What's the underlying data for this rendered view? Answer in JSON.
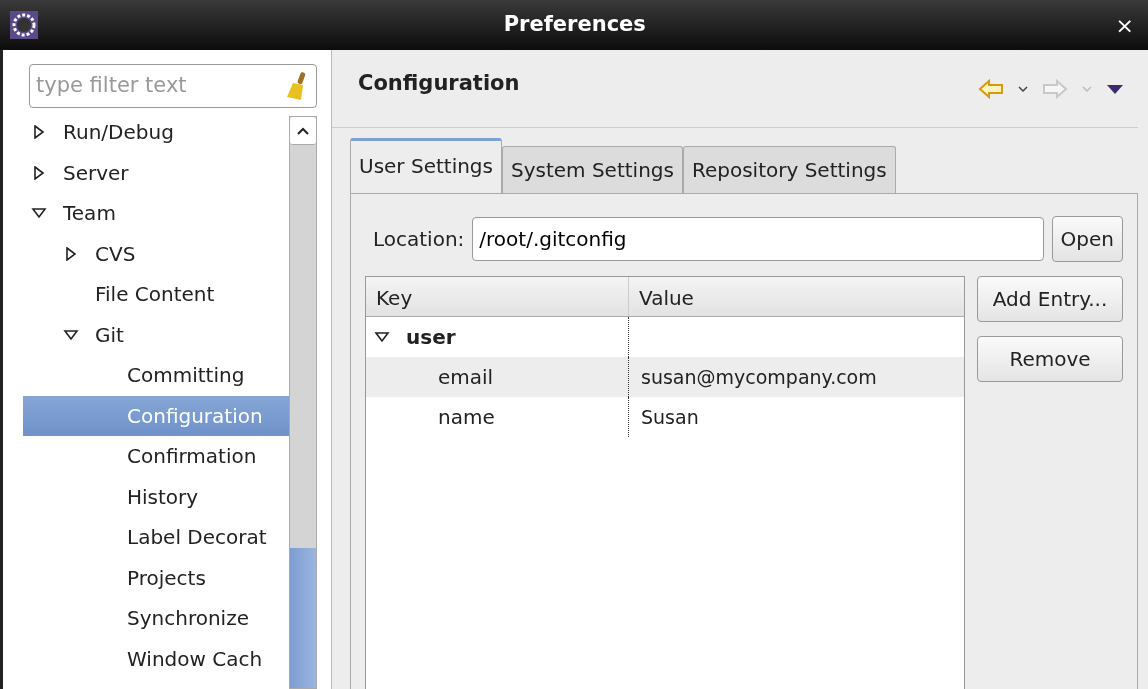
{
  "window": {
    "title": "Preferences",
    "close": "×"
  },
  "filter": {
    "placeholder": "type filter text"
  },
  "tree": [
    {
      "label": "Run/Debug",
      "expanded": false,
      "selected": false
    },
    {
      "label": "Server",
      "expanded": false,
      "selected": false
    },
    {
      "label": "Team",
      "expanded": true,
      "selected": false,
      "children": [
        {
          "label": "CVS",
          "expanded": false,
          "selected": false
        },
        {
          "label": "File Content",
          "selected": false
        },
        {
          "label": "Git",
          "expanded": true,
          "selected": false,
          "children": [
            {
              "label": "Committing",
              "selected": false
            },
            {
              "label": "Configuration",
              "selected": true
            },
            {
              "label": "Confirmation",
              "selected": false
            },
            {
              "label": "History",
              "selected": false
            },
            {
              "label": "Label Decorat",
              "selected": false
            },
            {
              "label": "Projects",
              "selected": false
            },
            {
              "label": "Synchronize",
              "selected": false
            },
            {
              "label": "Window Cach",
              "selected": false
            }
          ]
        }
      ]
    }
  ],
  "page": {
    "title": "Configuration"
  },
  "tabs": [
    {
      "label": "User Settings",
      "selected": true
    },
    {
      "label": "System Settings",
      "selected": false
    },
    {
      "label": "Repository Settings",
      "selected": false
    }
  ],
  "location": {
    "label": "Location:",
    "value": "/root/.gitconfig",
    "button": "Open"
  },
  "table": {
    "columns": [
      "Key",
      "Value"
    ],
    "rows": [
      {
        "key": "user",
        "value": "",
        "kind": "group",
        "expanded": true,
        "selected": false
      },
      {
        "key": "email",
        "value": "susan@mycompany.com",
        "kind": "entry",
        "selected": true
      },
      {
        "key": "name",
        "value": "Susan",
        "kind": "entry",
        "selected": false
      }
    ]
  },
  "buttons": [
    "Add Entry...",
    "Remove"
  ]
}
